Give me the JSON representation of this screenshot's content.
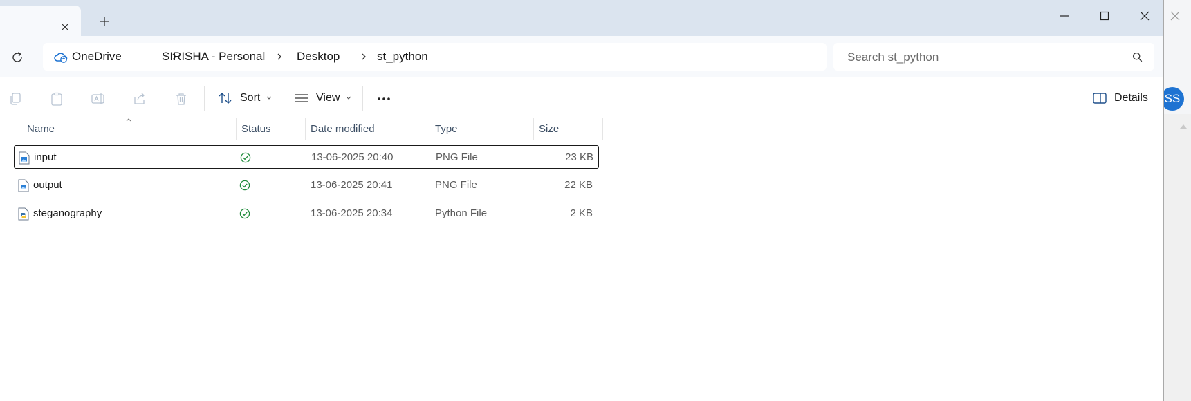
{
  "window": {
    "tab": {
      "close_icon": "close-icon"
    },
    "new_tab_icon": "plus-icon",
    "controls": [
      "minimize-icon",
      "maximize-icon",
      "close-icon"
    ]
  },
  "address_bar": {
    "breadcrumbs": [
      "OneDrive",
      "SIRISHA - Personal",
      "Desktop",
      "st_python"
    ],
    "root_icon": "onedrive-cloud-icon"
  },
  "search": {
    "placeholder": "Search st_python",
    "value": ""
  },
  "toolbar": {
    "actions": [
      "copy-icon",
      "paste-icon",
      "rename-icon",
      "share-icon",
      "delete-icon"
    ],
    "sort_label": "Sort",
    "view_label": "View",
    "more_icon": "more-icon",
    "details_label": "Details"
  },
  "columns": {
    "name": "Name",
    "status": "Status",
    "date": "Date modified",
    "type": "Type",
    "size": "Size"
  },
  "files": [
    {
      "name": "input",
      "date": "13-06-2025 20:40",
      "type": "PNG File",
      "size": "23 KB",
      "icon": "png-file-icon",
      "status": "synced"
    },
    {
      "name": "output",
      "date": "13-06-2025 20:41",
      "type": "PNG File",
      "size": "22 KB",
      "icon": "png-file-icon",
      "status": "synced"
    },
    {
      "name": "steganography",
      "date": "13-06-2025 20:34",
      "type": "Python File",
      "size": "2 KB",
      "icon": "python-file-icon",
      "status": "synced"
    }
  ],
  "background": {
    "avatar_initials": "SS"
  },
  "colors": {
    "accent": "#1e73d2",
    "status_ok": "#1f8b3b",
    "titlebar": "#dbe4ef"
  }
}
